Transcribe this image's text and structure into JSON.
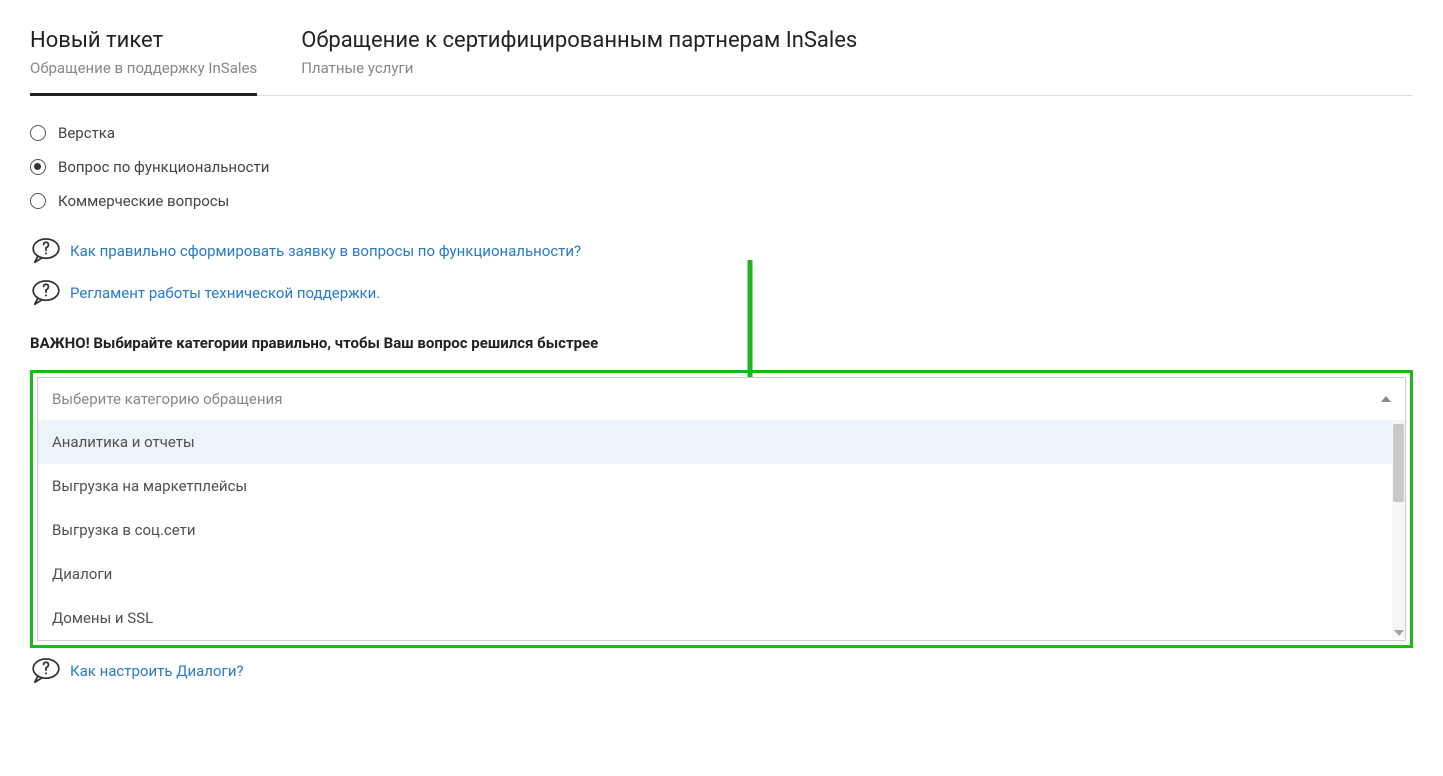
{
  "tabs": [
    {
      "title": "Новый тикет",
      "subtitle": "Обращение в поддержку InSales"
    },
    {
      "title": "Обращение к сертифицированным партнерам InSales",
      "subtitle": "Платные услуги"
    }
  ],
  "radios": [
    {
      "label": "Верстка",
      "selected": false
    },
    {
      "label": "Вопрос по функциональности",
      "selected": true
    },
    {
      "label": "Коммерческие вопросы",
      "selected": false
    }
  ],
  "helpLinks": [
    {
      "text": "Как правильно сформировать заявку в вопросы по функциональности?"
    },
    {
      "text": "Регламент работы технической поддержки."
    }
  ],
  "importantLabel": "ВАЖНО! Выбирайте категории правильно, чтобы Ваш вопрос решился быстрее",
  "dropdown": {
    "placeholder": "Выберите категорию обращения",
    "options": [
      "Аналитика и отчеты",
      "Выгрузка на маркетплейсы",
      "Выгрузка в соц.сети",
      "Диалоги",
      "Домены и SSL"
    ]
  },
  "bottomHelpLink": "Как настроить Диалоги?",
  "annotationColor": "#1db61d"
}
